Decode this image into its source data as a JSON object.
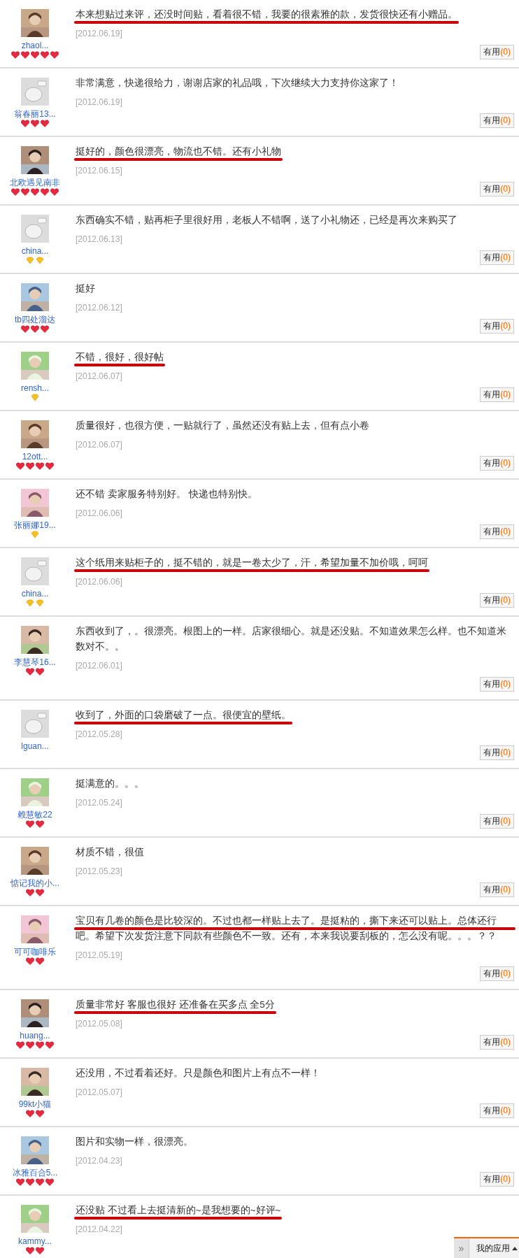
{
  "reviews": [
    {
      "avatar": {
        "kind": "picture"
      },
      "name": "zhaol...",
      "rank": [
        {
          "kind": "heart"
        },
        {
          "kind": "heart"
        },
        {
          "kind": "heart"
        },
        {
          "kind": "heart"
        },
        {
          "kind": "heart"
        }
      ],
      "text": "本来想贴过来评，还没时间贴，看着很不错，我要的很素雅的款，发货很快还有小赠品。",
      "highlighted": true,
      "date": "[2012.06.19]",
      "useful": {
        "label": "有用",
        "count": "(0)"
      }
    },
    {
      "avatar": {
        "kind": "default"
      },
      "name": "翁春丽13...",
      "rank": [
        {
          "kind": "heart"
        },
        {
          "kind": "heart"
        },
        {
          "kind": "heart"
        }
      ],
      "text": "非常满意，快递很给力，谢谢店家的礼品哦，下次继续大力支持你这家了！",
      "highlighted": false,
      "date": "[2012.06.19]",
      "useful": {
        "label": "有用",
        "count": "(0)"
      }
    },
    {
      "avatar": {
        "kind": "picture"
      },
      "name": "北欧遇见南非",
      "rank": [
        {
          "kind": "heart"
        },
        {
          "kind": "heart"
        },
        {
          "kind": "heart"
        },
        {
          "kind": "heart"
        },
        {
          "kind": "heart"
        }
      ],
      "text": "挺好的，颜色很漂亮，物流也不错。还有小礼物",
      "highlighted": true,
      "date": "[2012.06.15]",
      "useful": {
        "label": "有用",
        "count": "(0)"
      }
    },
    {
      "avatar": {
        "kind": "default"
      },
      "name": "china...",
      "rank": [
        {
          "kind": "diamond"
        },
        {
          "kind": "diamond"
        }
      ],
      "text": "东西确实不错，贴再柜子里很好用，老板人不错啊，送了小礼物还，已经是再次来购买了",
      "highlighted": false,
      "date": "[2012.06.13]",
      "useful": {
        "label": "有用",
        "count": "(0)"
      }
    },
    {
      "avatar": {
        "kind": "picture"
      },
      "name": "tb四处溜达",
      "rank": [
        {
          "kind": "heart"
        },
        {
          "kind": "heart"
        },
        {
          "kind": "heart"
        }
      ],
      "text": "挺好",
      "highlighted": false,
      "date": "[2012.06.12]",
      "useful": {
        "label": "有用",
        "count": "(0)"
      }
    },
    {
      "avatar": {
        "kind": "picture"
      },
      "name": "rensh...",
      "rank": [
        {
          "kind": "diamond"
        }
      ],
      "text": "不错，很好，很好帖",
      "highlighted": true,
      "date": "[2012.06.07]",
      "useful": {
        "label": "有用",
        "count": "(0)"
      }
    },
    {
      "avatar": {
        "kind": "picture"
      },
      "name": "12ott...",
      "rank": [
        {
          "kind": "heart"
        },
        {
          "kind": "heart"
        },
        {
          "kind": "heart"
        },
        {
          "kind": "heart"
        }
      ],
      "text": "质量很好，也很方便，一贴就行了，虽然还没有贴上去，但有点小卷",
      "highlighted": false,
      "date": "[2012.06.07]",
      "useful": {
        "label": "有用",
        "count": "(0)"
      }
    },
    {
      "avatar": {
        "kind": "picture"
      },
      "name": "张丽娜19...",
      "rank": [
        {
          "kind": "diamond"
        }
      ],
      "text": "还不错 卖家服务特别好。 快递也特别快。",
      "highlighted": false,
      "date": "[2012.06.06]",
      "useful": {
        "label": "有用",
        "count": "(0)"
      }
    },
    {
      "avatar": {
        "kind": "default"
      },
      "name": "china...",
      "rank": [
        {
          "kind": "diamond"
        },
        {
          "kind": "diamond"
        }
      ],
      "text": "这个纸用来贴柜子的，挺不错的，就是一卷太少了，汗，希望加量不加价哦，呵呵",
      "highlighted": true,
      "date": "[2012.06.06]",
      "useful": {
        "label": "有用",
        "count": "(0)"
      }
    },
    {
      "avatar": {
        "kind": "picture"
      },
      "name": "李慧琴16...",
      "rank": [
        {
          "kind": "heart"
        },
        {
          "kind": "heart"
        }
      ],
      "text": "东西收到了，。很漂亮。根图上的一样。店家很细心。就是还没贴。不知道效果怎么样。也不知道米数对不。。",
      "highlighted": false,
      "date": "[2012.06.01]",
      "useful": {
        "label": "有用",
        "count": "(0)"
      }
    },
    {
      "avatar": {
        "kind": "default"
      },
      "name": "lguan...",
      "text": "收到了，外面的口袋磨破了一点。很便宜的壁纸。",
      "highlighted": true,
      "date": "[2012.05.28]",
      "useful": {
        "label": "有用",
        "count": "(0)"
      }
    },
    {
      "avatar": {
        "kind": "picture"
      },
      "name": "赖慧敏22",
      "rank": [
        {
          "kind": "heart"
        },
        {
          "kind": "heart"
        }
      ],
      "text": "挺满意的。。。",
      "highlighted": false,
      "date": "[2012.05.24]",
      "useful": {
        "label": "有用",
        "count": "(0)"
      }
    },
    {
      "avatar": {
        "kind": "picture"
      },
      "name": "惦记我的小...",
      "rank": [
        {
          "kind": "heart"
        },
        {
          "kind": "heart"
        }
      ],
      "text": "材质不错，很值",
      "highlighted": false,
      "date": "[2012.05.23]",
      "useful": {
        "label": "有用",
        "count": "(0)"
      }
    },
    {
      "avatar": {
        "kind": "picture"
      },
      "name": "可可咖啡乐",
      "rank": [
        {
          "kind": "heart"
        },
        {
          "kind": "heart"
        }
      ],
      "text": "宝贝有几卷的颜色是比较深的。不过也都一样贴上去了。是挺粘的，撕下来还可以贴上。总体还行吧。希望下次发货注意下同款有些颜色不一致。还有，本来我说要刮板的，怎么没有呢。。。？？",
      "highlighted": true,
      "date": "[2012.05.19]",
      "useful": {
        "label": "有用",
        "count": "(0)"
      }
    },
    {
      "avatar": {
        "kind": "picture"
      },
      "name": "huang...",
      "rank": [
        {
          "kind": "heart"
        },
        {
          "kind": "heart"
        },
        {
          "kind": "heart"
        },
        {
          "kind": "heart"
        }
      ],
      "text": "质量非常好 客服也很好 还准备在买多点 全5分",
      "highlighted": true,
      "date": "[2012.05.08]",
      "useful": {
        "label": "有用",
        "count": "(0)"
      }
    },
    {
      "avatar": {
        "kind": "picture"
      },
      "name": "99kt小猫",
      "rank": [
        {
          "kind": "heart"
        },
        {
          "kind": "heart"
        }
      ],
      "text": "还没用，不过看着还好。只是颜色和图片上有点不一样！",
      "highlighted": false,
      "date": "[2012.05.07]",
      "useful": {
        "label": "有用",
        "count": "(0)"
      }
    },
    {
      "avatar": {
        "kind": "picture"
      },
      "name": "冰雅百合5...",
      "rank": [
        {
          "kind": "heart"
        },
        {
          "kind": "heart"
        },
        {
          "kind": "heart"
        },
        {
          "kind": "heart"
        }
      ],
      "text": "图片和实物一样，很漂亮。",
      "highlighted": false,
      "date": "[2012.04.23]",
      "useful": {
        "label": "有用",
        "count": "(0)"
      }
    },
    {
      "avatar": {
        "kind": "picture"
      },
      "name": "kammy...",
      "rank": [
        {
          "kind": "heart"
        },
        {
          "kind": "heart"
        }
      ],
      "text": "还没贴 不过看上去挺清新的~是我想要的~好评~",
      "highlighted": true,
      "date": "[2012.04.22]"
    }
  ],
  "app_bar": {
    "toggle": "»",
    "label": "我的应用"
  }
}
